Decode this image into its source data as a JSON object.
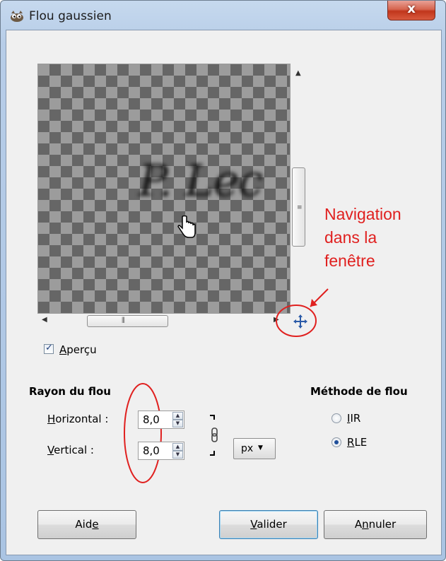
{
  "window": {
    "title": "Flou gaussien",
    "close_label": "x",
    "app_icon": "gimp-wilber-icon"
  },
  "preview": {
    "blurred_text": "P. Lec",
    "cursor_icon": "hand-pointer-icon",
    "nav_icon": "move-arrows-icon"
  },
  "annotation": {
    "lines": [
      "Navigation",
      "dans la",
      "fenêtre"
    ],
    "color": "#e0201f"
  },
  "apercu": {
    "checked": true,
    "label_underlined": "A",
    "label_rest": "perçu"
  },
  "rayon": {
    "heading": "Rayon du flou",
    "horizontal": {
      "label_underlined": "H",
      "label_rest": "orizontal :",
      "value": "8,0"
    },
    "vertical": {
      "label_underlined": "V",
      "label_rest": "ertical :",
      "value": "8,0"
    },
    "chain_icon": "chain-link-icon",
    "unit": "px"
  },
  "methode": {
    "heading": "Méthode de flou",
    "options": [
      {
        "underlined": "I",
        "rest": "IR",
        "checked": false
      },
      {
        "underlined": "R",
        "rest": "LE",
        "checked": true
      }
    ]
  },
  "buttons": {
    "aide": {
      "before": "Aid",
      "underlined": "e",
      "after": ""
    },
    "valider": {
      "before": "",
      "underlined": "V",
      "after": "alider"
    },
    "annuler": {
      "before": "A",
      "underlined": "n",
      "after": "nuler"
    }
  }
}
